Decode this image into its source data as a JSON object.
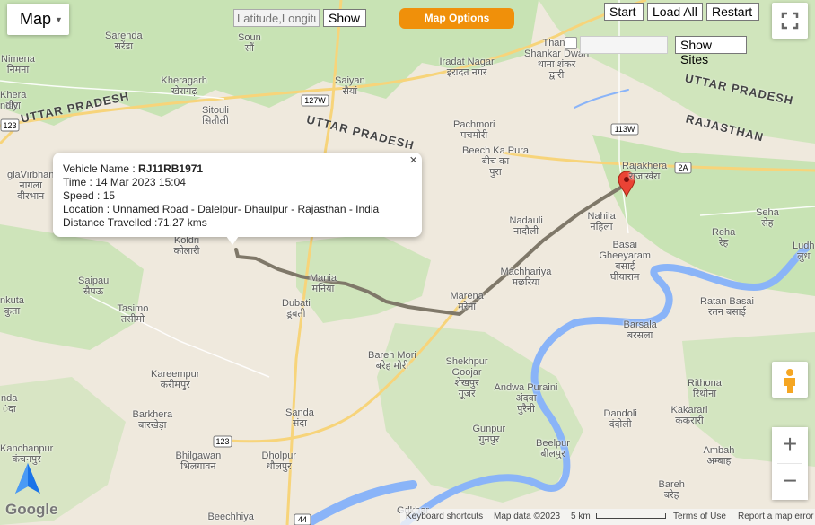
{
  "map": {
    "type_button": "Map",
    "lat_placeholder": "Latitude,Longitude",
    "show_label": "Show",
    "map_options_label": "Map Options",
    "start_label": "Start",
    "load_all_label": "Load All",
    "restart_label": "Restart",
    "show_sites_label": "Show Sites",
    "fullscreen_icon": "fullscreen-icon",
    "pegman_icon": "pegman-icon",
    "zoom_in": "+",
    "zoom_out": "−",
    "google": "Google"
  },
  "colors": {
    "land": "#efe9dd",
    "green": "#c8e3b4",
    "river": "#8ab4f8",
    "route": "#7f7869",
    "road": "#f7d47a",
    "accent": "#f0900a"
  },
  "info": {
    "vehicle_label": "Vehicle Name : ",
    "vehicle": "RJ11RB1971",
    "time": "Time : 14 Mar 2023 15:04",
    "speed": "Speed : 15",
    "location": "Location : Unnamed Road - Dalelpur- Dhaulpur - Rajasthan - India",
    "distance": "Distance Travelled :71.27 kms",
    "close": "×"
  },
  "states": [
    "UTTAR PRADESH",
    "UTTAR PRADESH",
    "UTTAR PRADESH",
    "RAJASTHAN"
  ],
  "roads": [
    "123",
    "127W",
    "113W",
    "2A",
    "123",
    "44"
  ],
  "places": [
    "Sarenda\nसरेंडा",
    "Nimena\nनिमना",
    "Khera\nखेरा",
    "ndly",
    "Kheragarh\nखेरागढ़",
    "Soun\nसौं",
    "Saiyan\nसैयां",
    "Sitouli\nसितौली",
    "Iradat Nagar\nइरादत नगर",
    "Thana\nShankar Dwari\nथाना शंकर\nद्वारी",
    "Pachmori\nपचमोरी",
    "Beech Ka Pura\nबीच का\nपुरा",
    "Rajakhera\nराजाखेरा",
    "glaVirbhan\nनागला\nवीरभान",
    "Koldri\nकोलारी",
    "Nadauli\nनादौली",
    "Nahila\nनहिला",
    "Seha\nसेह",
    "Reha\nरेह",
    "Basai\nGheeyaram\nबसाई\nघीयाराम",
    "Machhariya\nमछरिया",
    "Saipau\nसैपऊ",
    "nkuta\nकुता",
    "Tasimo\nतसीमो",
    "Mania\nमनिया",
    "Dubati\nडूबती",
    "Marena\nमरेना",
    "Ratan Basai\nरतन बसाई",
    "Barsala\nबरसला",
    "Bareh Mori\nबरेह मोरी",
    "Shekhpur\nGoojar\nशेखपुर\nगूजर",
    "Andwa Puraini\nअंदवा\nपुरैनी",
    "Kareempur\nकरीमपुर",
    "Rithona\nरिथोना",
    "Barkhera\nबारखेड़ा",
    "Sanda\nसंदा",
    "Dandoli\nदंदोली",
    "Kakarari\nककरारी",
    "Gunpur\nगुनपुर",
    "Beelpur\nबीलपुर",
    "Bhilgawan\nभिलगावन",
    "Dholpur\nधौलपुर",
    "Kanchanpur\nकंचनपुर",
    "Ambah\nअम्बाह",
    "Bareh\nबरेह",
    "Beechhiya",
    "nda\nंदा",
    "Gdkhar",
    "Ludh\nलुध"
  ],
  "footer": {
    "shortcuts": "Keyboard shortcuts",
    "mapdata": "Map data ©2023",
    "scale": "5 km",
    "terms": "Terms of Use",
    "report": "Report a map error"
  }
}
